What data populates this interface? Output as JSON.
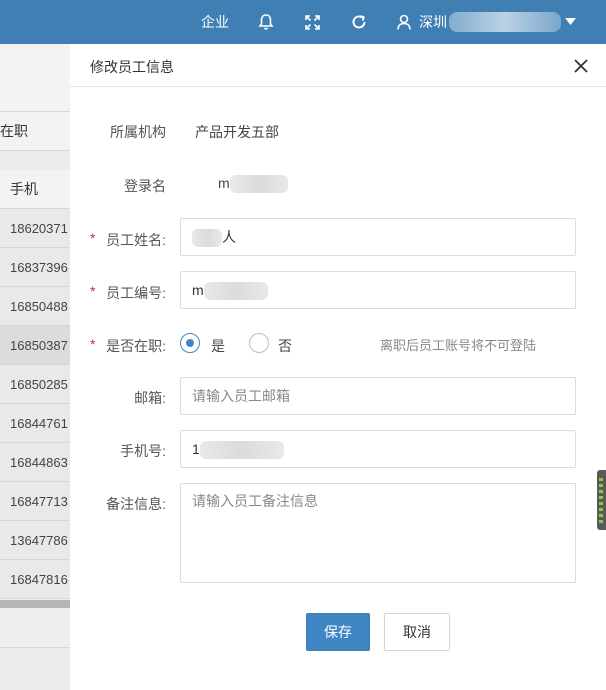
{
  "topbar": {
    "enterprise_label": "企业",
    "user_label": "深圳",
    "icons": [
      "bell-icon",
      "fullscreen-icon",
      "refresh-icon",
      "user-icon",
      "caret-down-icon"
    ]
  },
  "background": {
    "fragment_label": "在职",
    "column_header": "手机",
    "rows": [
      "18620371",
      "16837396",
      "16850488",
      "16850387",
      "16850285",
      "16844761",
      "16844863",
      "16847713",
      "13647786",
      "16847816"
    ]
  },
  "dialog": {
    "title": "修改员工信息",
    "close_icon": "close-icon",
    "fields": {
      "org": {
        "label": "所属机构",
        "value": "产品开发五部"
      },
      "login": {
        "label": "登录名",
        "value": "m"
      },
      "name": {
        "label": "员工姓名:",
        "value": "人"
      },
      "code": {
        "label": "员工编号:",
        "value": "m"
      },
      "active": {
        "label": "是否在职:",
        "yes": "是",
        "no": "否",
        "selected": "是",
        "hint": "离职后员工账号将不可登陆"
      },
      "email": {
        "label": "邮箱:",
        "placeholder": "请输入员工邮箱"
      },
      "phone": {
        "label": "手机号:",
        "value": "1"
      },
      "remark": {
        "label": "备注信息:",
        "placeholder": "请输入员工备注信息"
      }
    },
    "required_mark": "*",
    "save_label": "保存",
    "cancel_label": "取消"
  },
  "colors": {
    "topbar": "#3f7fb4",
    "primary": "#3f87c4",
    "required": "#c9302c"
  }
}
